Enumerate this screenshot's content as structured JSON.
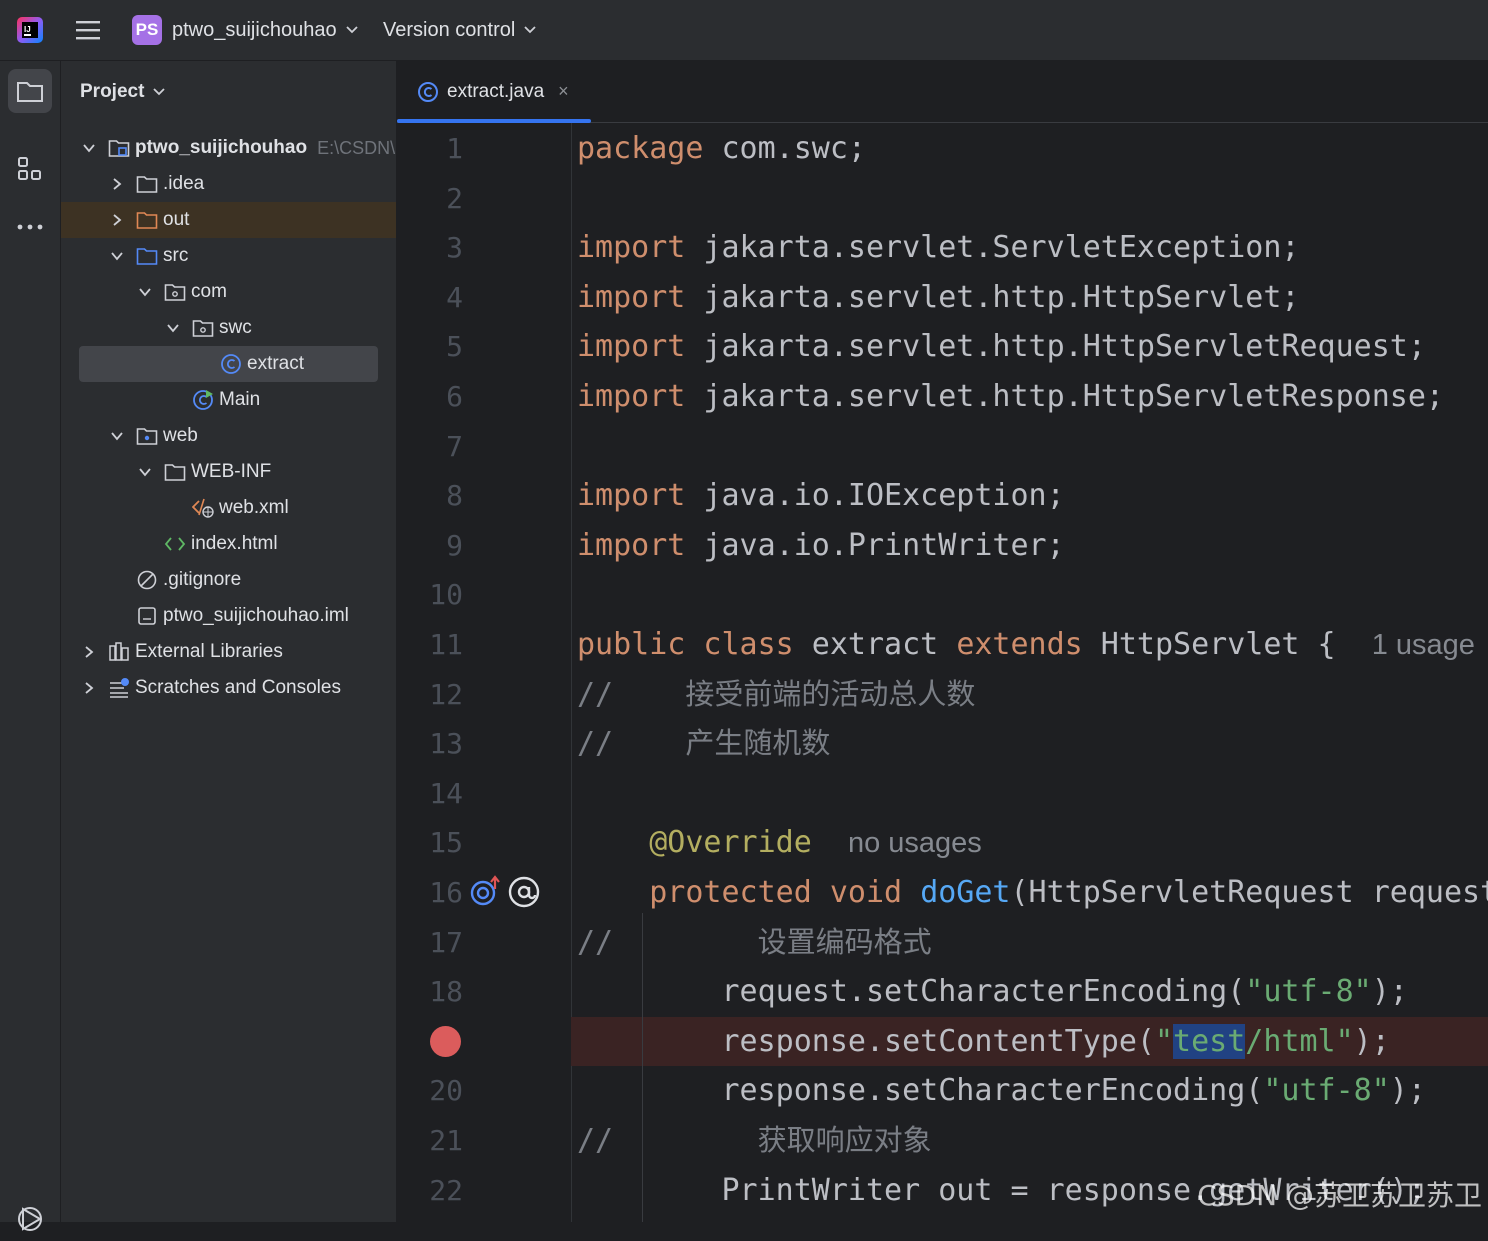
{
  "topbar": {
    "project_badge": "PS",
    "project_name": "ptwo_suijichouhao",
    "vcs_label": "Version control"
  },
  "project_panel": {
    "title": "Project",
    "tree": [
      {
        "label": "ptwo_suijichouhao",
        "hint": "E:\\CSDN\\",
        "bold": true,
        "depth": 0,
        "arrow": "down",
        "icon": "module-folder-icon"
      },
      {
        "label": ".idea",
        "depth": 1,
        "arrow": "right",
        "icon": "folder-icon"
      },
      {
        "label": "out",
        "depth": 1,
        "arrow": "right",
        "icon": "folder-excluded-icon",
        "state": "excluded"
      },
      {
        "label": "src",
        "depth": 1,
        "arrow": "down",
        "icon": "source-folder-icon"
      },
      {
        "label": "com",
        "depth": 2,
        "arrow": "down",
        "icon": "package-icon"
      },
      {
        "label": "swc",
        "depth": 3,
        "arrow": "down",
        "icon": "package-icon"
      },
      {
        "label": "extract",
        "depth": 4,
        "arrow": "none",
        "icon": "java-class-icon",
        "state": "selected"
      },
      {
        "label": "Main",
        "depth": 3,
        "arrow": "none",
        "icon": "java-main-class-icon"
      },
      {
        "label": "web",
        "depth": 1,
        "arrow": "down",
        "icon": "web-folder-icon"
      },
      {
        "label": "WEB-INF",
        "depth": 2,
        "arrow": "down",
        "icon": "folder-icon"
      },
      {
        "label": "web.xml",
        "depth": 3,
        "arrow": "none",
        "icon": "xml-file-icon"
      },
      {
        "label": "index.html",
        "depth": 2,
        "arrow": "none",
        "icon": "html-file-icon"
      },
      {
        "label": ".gitignore",
        "depth": 1,
        "arrow": "none",
        "icon": "ignore-file-icon"
      },
      {
        "label": "ptwo_suijichouhao.iml",
        "depth": 1,
        "arrow": "none",
        "icon": "iml-file-icon"
      },
      {
        "label": "External Libraries",
        "depth": 0,
        "arrow": "right",
        "icon": "libraries-icon"
      },
      {
        "label": "Scratches and Consoles",
        "depth": 0,
        "arrow": "right",
        "icon": "scratches-icon"
      }
    ]
  },
  "editor": {
    "tab_label": "extract.java",
    "close_glyph": "×",
    "breakpoint_line": 19,
    "lines": [
      {
        "n": "1",
        "segs": [
          [
            "kw",
            "package"
          ],
          [
            "t",
            " com.swc;"
          ]
        ]
      },
      {
        "n": "2",
        "segs": []
      },
      {
        "n": "3",
        "segs": [
          [
            "kw",
            "import"
          ],
          [
            "t",
            " jakarta.servlet.ServletException;"
          ]
        ]
      },
      {
        "n": "4",
        "segs": [
          [
            "kw",
            "import"
          ],
          [
            "t",
            " jakarta.servlet.http.HttpServlet;"
          ]
        ]
      },
      {
        "n": "5",
        "segs": [
          [
            "kw",
            "import"
          ],
          [
            "t",
            " jakarta.servlet.http.HttpServletRequest;"
          ]
        ]
      },
      {
        "n": "6",
        "segs": [
          [
            "kw",
            "import"
          ],
          [
            "t",
            " jakarta.servlet.http.HttpServletResponse;"
          ]
        ]
      },
      {
        "n": "7",
        "segs": []
      },
      {
        "n": "8",
        "segs": [
          [
            "kw",
            "import"
          ],
          [
            "t",
            " java.io.IOException;"
          ]
        ]
      },
      {
        "n": "9",
        "segs": [
          [
            "kw",
            "import"
          ],
          [
            "t",
            " java.io.PrintWriter;"
          ]
        ]
      },
      {
        "n": "10",
        "segs": []
      },
      {
        "n": "11",
        "segs": [
          [
            "kw",
            "public class"
          ],
          [
            "t",
            " extract "
          ],
          [
            "kw",
            "extends"
          ],
          [
            "t",
            " HttpServlet {  "
          ],
          [
            "hint",
            "1 usage"
          ]
        ]
      },
      {
        "n": "12",
        "segs": [
          [
            "cmt",
            "//    "
          ],
          [
            "cmtzh",
            "接受前端的活动总人数"
          ]
        ]
      },
      {
        "n": "13",
        "segs": [
          [
            "cmt",
            "//    "
          ],
          [
            "cmtzh",
            "产生随机数"
          ]
        ]
      },
      {
        "n": "14",
        "segs": []
      },
      {
        "n": "15",
        "segs": [
          [
            "t",
            "    "
          ],
          [
            "ann",
            "@Override"
          ],
          [
            "t",
            "  "
          ],
          [
            "hint",
            "no usages"
          ]
        ]
      },
      {
        "n": "16",
        "segs": [
          [
            "t",
            "    "
          ],
          [
            "kw",
            "protected void"
          ],
          [
            "t",
            " "
          ],
          [
            "fn",
            "doGet"
          ],
          [
            "t",
            "(HttpServletRequest request"
          ]
        ]
      },
      {
        "n": "17",
        "segs": [
          [
            "cmt",
            "//        "
          ],
          [
            "cmtzh",
            "设置编码格式"
          ]
        ]
      },
      {
        "n": "18",
        "segs": [
          [
            "t",
            "        request.setCharacterEncoding("
          ],
          [
            "str",
            "\"utf-8\""
          ],
          [
            "t",
            ");"
          ]
        ]
      },
      {
        "n": "19",
        "segs": [
          [
            "t",
            "        response.setContentType("
          ],
          [
            "str",
            "\""
          ],
          [
            "strhl",
            "test"
          ],
          [
            "str",
            "/html\""
          ],
          [
            "t",
            ");"
          ]
        ]
      },
      {
        "n": "20",
        "segs": [
          [
            "t",
            "        response.setCharacterEncoding("
          ],
          [
            "str",
            "\"utf-8\""
          ],
          [
            "t",
            ");"
          ]
        ]
      },
      {
        "n": "21",
        "segs": [
          [
            "cmt",
            "//        "
          ],
          [
            "cmtzh",
            "获取响应对象"
          ]
        ]
      },
      {
        "n": "22",
        "segs": [
          [
            "t",
            "        PrintWriter out = response.getWriter();"
          ]
        ]
      }
    ]
  },
  "watermark": "CSDN @苏卫苏卫苏卫",
  "colors": {
    "keyword": "#cf8e6d",
    "string": "#6aab73",
    "function": "#56a8f5",
    "annotation": "#b3ae60",
    "comment": "#7a7e85",
    "breakpoint": "#db5c5c",
    "accent": "#3574f0"
  }
}
